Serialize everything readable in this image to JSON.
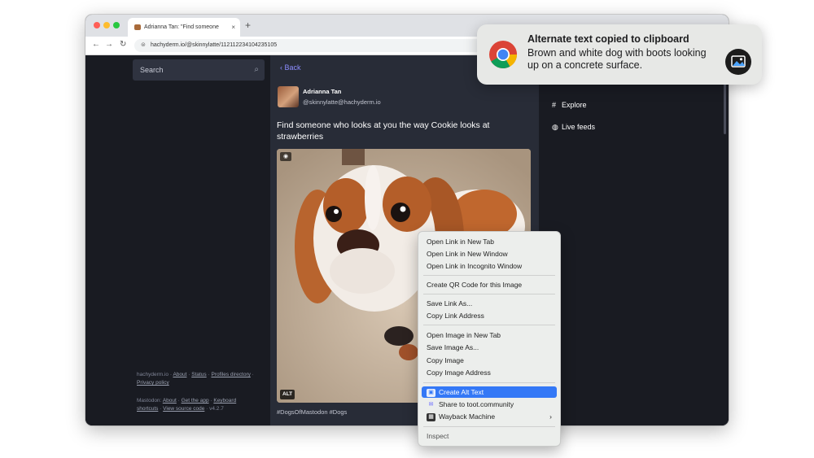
{
  "browser": {
    "tab_title": "Adrianna Tan: \"Find someone",
    "tab_close": "×",
    "new_tab": "+",
    "url": "hachyderm.io/@skinnylatte/112112234104235105"
  },
  "sidebar": {
    "search_placeholder": "Search",
    "footer1": {
      "site": "hachyderm.io",
      "links": [
        "About",
        "Status",
        "Profiles directory",
        "Privacy policy"
      ]
    },
    "footer2": {
      "site": "Mastodon",
      "links": [
        "About",
        "Get the app",
        "Keyboard shortcuts",
        "View source code"
      ],
      "version": "v4.2.7"
    }
  },
  "post": {
    "back_label": "Back",
    "author_name": "Adrianna Tan",
    "author_handle": "@skinnylatte@hachyderm.io",
    "text": "Find someone who looks at you the way Cookie looks at strawberries",
    "alt_badge": "ALT",
    "hashtags": "#DogsOfMastodon #Dogs"
  },
  "right_nav": {
    "explore": "Explore",
    "live_feeds": "Live feeds"
  },
  "context_menu": {
    "items": [
      "Open Link in New Tab",
      "Open Link in New Window",
      "Open Link in Incognito Window",
      "Create QR Code for this Image",
      "Save Link As...",
      "Copy Link Address",
      "Open Image in New Tab",
      "Save Image As...",
      "Copy Image",
      "Copy Image Address",
      "Create Alt Text",
      "Share to toot.community",
      "Wayback Machine",
      "Inspect"
    ],
    "highlighted": "Create Alt Text",
    "accent": "#3478f6"
  },
  "notification": {
    "title": "Alternate text copied to clipboard",
    "body": "Brown and white dog with boots looking up on a concrete surface."
  },
  "colors": {
    "mastodon_bg": "#191b22",
    "column_bg": "#282c37",
    "link": "#8c8dff"
  }
}
